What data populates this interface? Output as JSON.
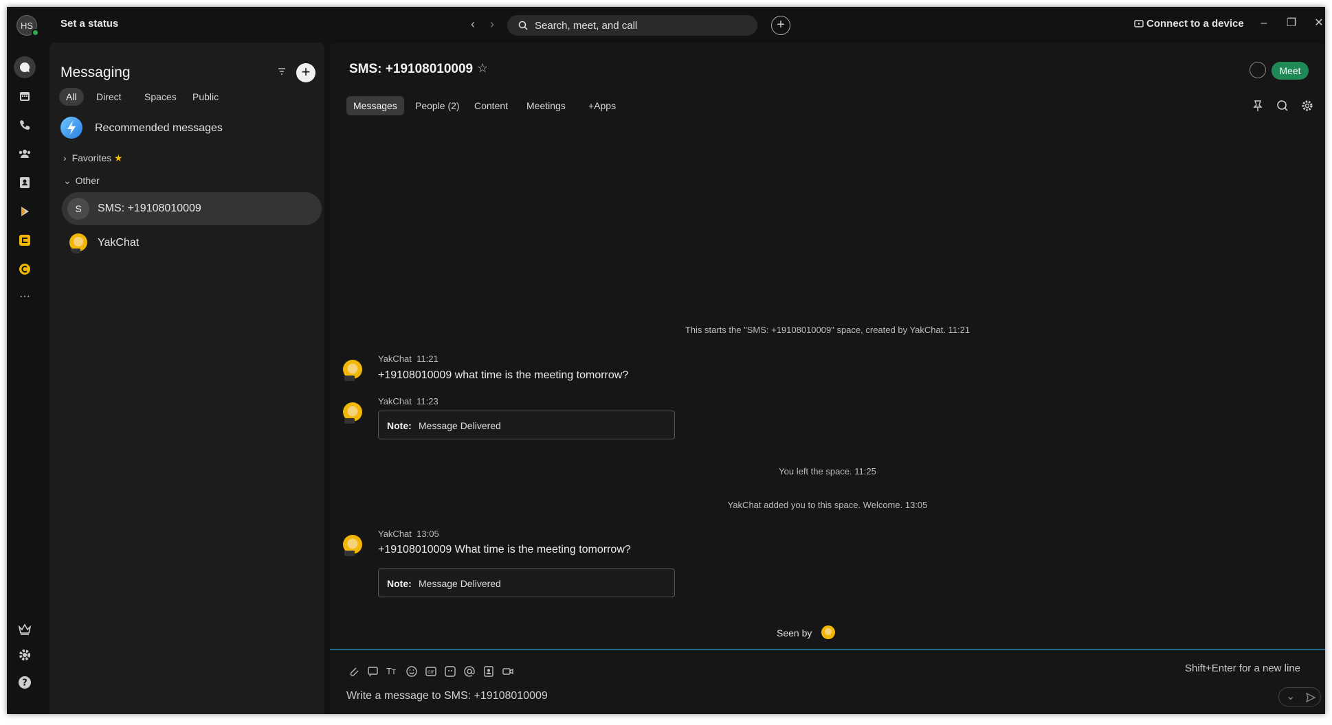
{
  "titlebar": {
    "avatar_initials": "HS",
    "status_label": "Set a status",
    "search_placeholder": "Search, meet, and call",
    "connect_label": "Connect to a device"
  },
  "sidebar": {
    "title": "Messaging",
    "filters": [
      "All",
      "Direct",
      "Spaces",
      "Public"
    ],
    "active_filter": "All",
    "recommended_label": "Recommended messages",
    "favorites_label": "Favorites",
    "other_label": "Other",
    "conversations": [
      {
        "initial": "S",
        "label": "SMS: +19108010009",
        "selected": true
      },
      {
        "initial": "",
        "label": "YakChat",
        "selected": false
      }
    ]
  },
  "space": {
    "title": "SMS: +19108010009",
    "meet_label": "Meet",
    "tabs": [
      "Messages",
      "People (2)",
      "Content",
      "Meetings",
      "+Apps"
    ],
    "active_tab": "Messages"
  },
  "messages": {
    "system_start": "This starts the \"SMS: +19108010009\" space, created by YakChat. 11:21",
    "items": [
      {
        "sender": "YakChat",
        "time": "11:21",
        "text": "+19108010009 what time is the meeting tomorrow?"
      },
      {
        "sender": "YakChat",
        "time": "11:23",
        "note_label": "Note:",
        "note_text": "Message Delivered"
      },
      {
        "sender": "YakChat",
        "time": "13:05",
        "text": "+19108010009 What time is the meeting tomorrow?",
        "note_label": "Note:",
        "note_text": "Message Delivered"
      }
    ],
    "system_left": "You left the space. 11:25",
    "system_added": "YakChat added you to this space. Welcome. 13:05",
    "seen_by": "Seen by"
  },
  "composer": {
    "hint": "Shift+Enter for a new line",
    "placeholder": "Write a message to SMS: +19108010009"
  },
  "colors": {
    "accent_green": "#1f8a56",
    "presence": "#2fa84f",
    "composer_border": "#1f6a8a"
  }
}
